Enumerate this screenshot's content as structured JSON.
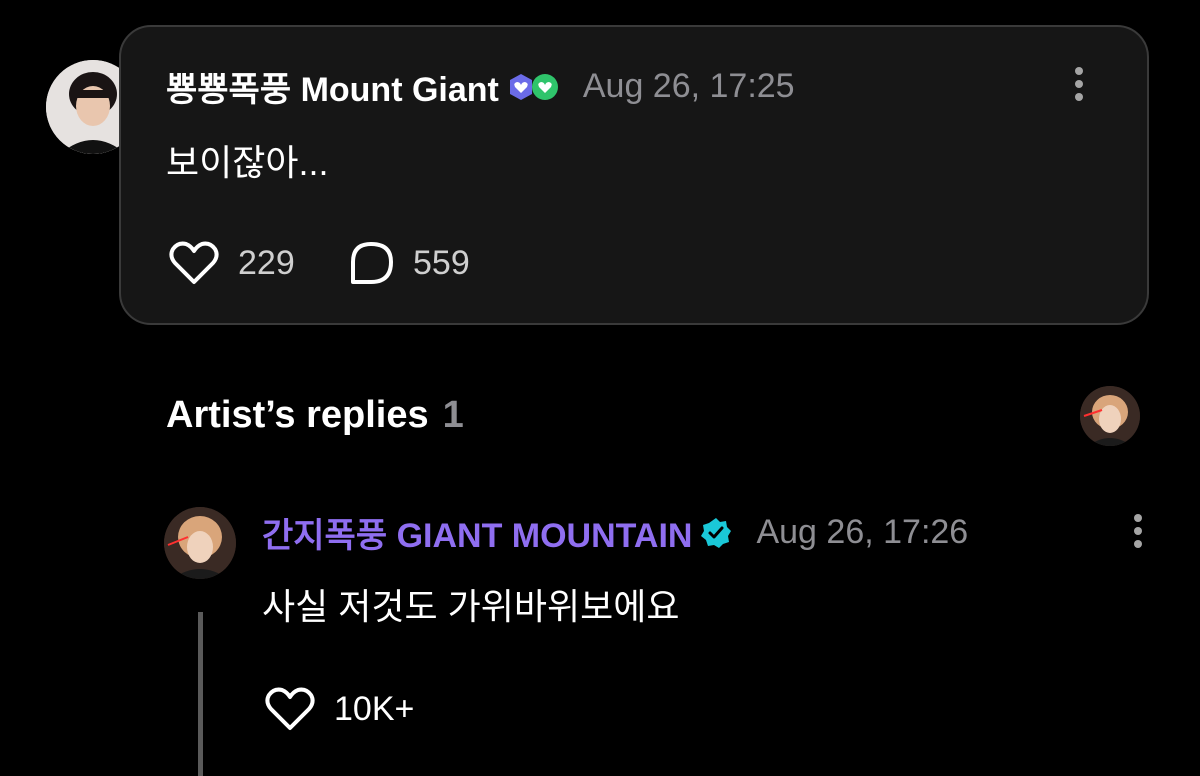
{
  "post": {
    "author": "뿅뿅폭풍 Mount Giant",
    "timestamp": "Aug 26, 17:25",
    "text": "보이잖아...",
    "likes": "229",
    "comments": "559",
    "badges": [
      "heart-badge-purple-icon",
      "heart-badge-green-icon"
    ]
  },
  "artist_replies": {
    "title": "Artist’s replies",
    "count": "1"
  },
  "reply": {
    "author": "간지폭풍 GIANT MOUNTAIN",
    "timestamp": "Aug 26, 17:26",
    "text": "사실 저것도 가위바위보에요",
    "likes": "10K+"
  },
  "colors": {
    "background": "#000000",
    "card": "#161616",
    "artist_name": "#8f6ef0",
    "verified": "#1ac8d8",
    "muted": "#8e8e93"
  }
}
